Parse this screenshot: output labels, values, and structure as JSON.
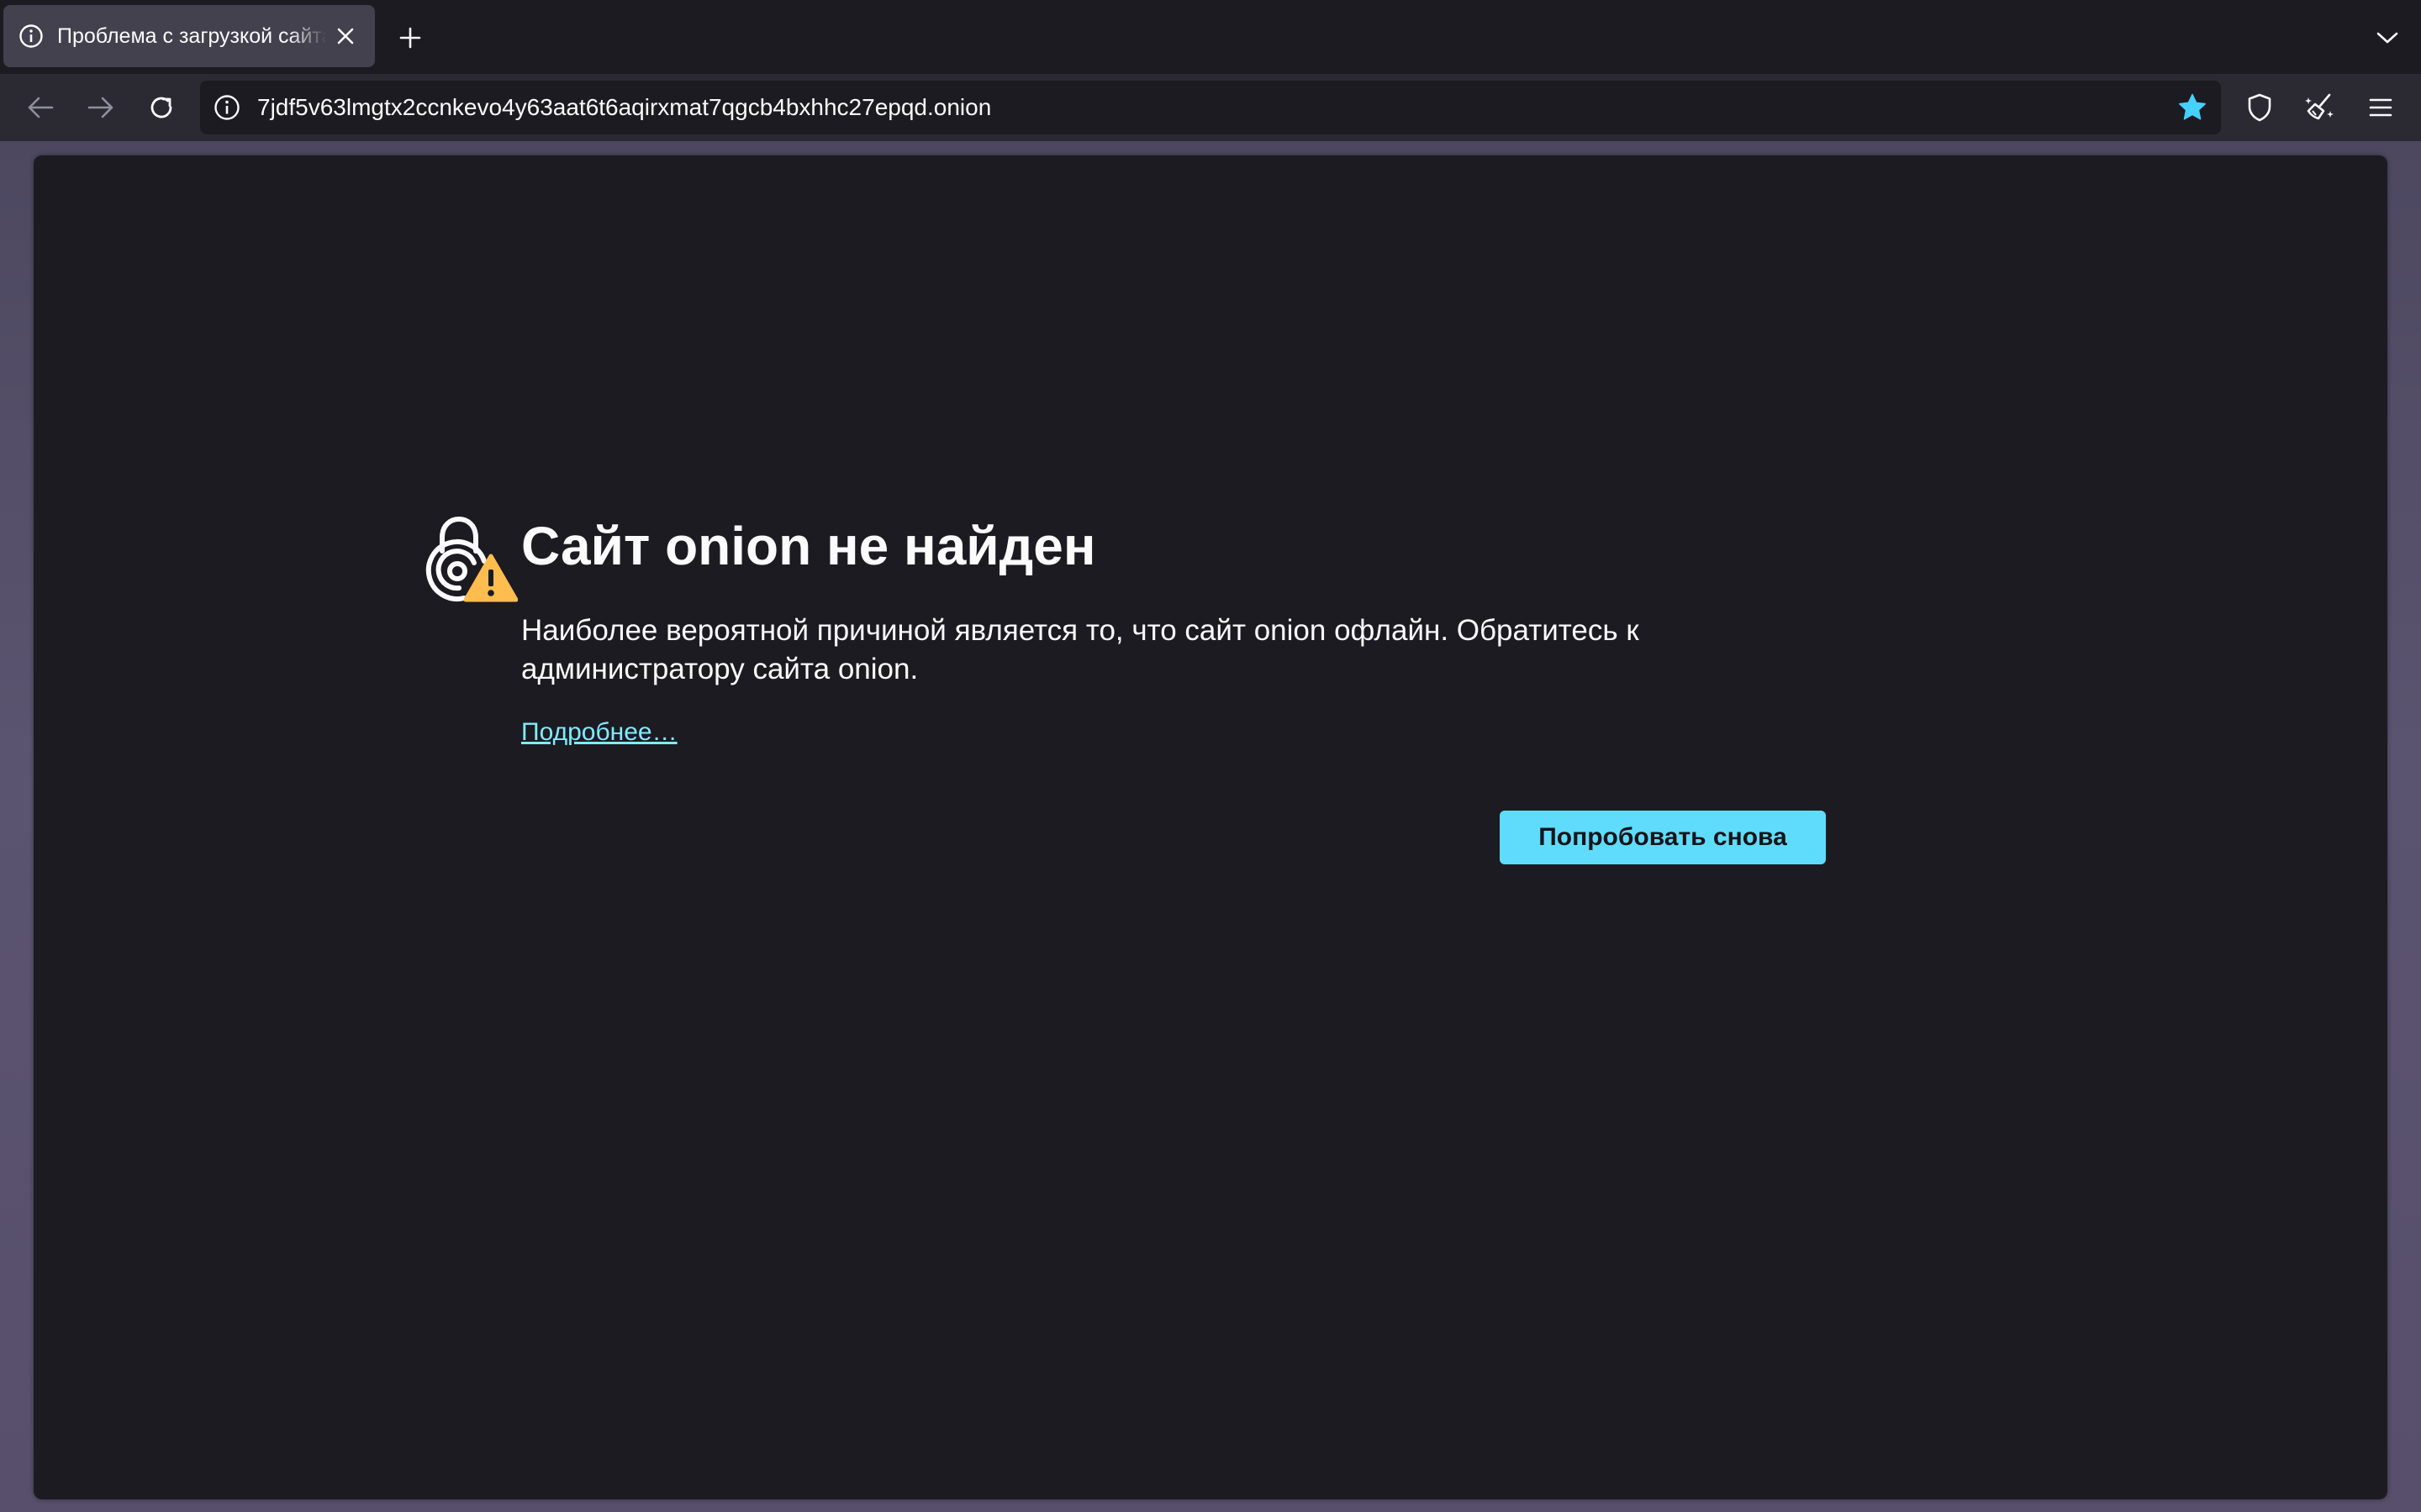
{
  "tab": {
    "title": "Проблема с загрузкой сайта Onion"
  },
  "urlbar": {
    "url": "7jdf5v63lmgtx2ccnkevo4y63aat6t6aqirxmat7qgcb4bxhhc27epqd.onion"
  },
  "icons": {
    "tab_info": "info-icon",
    "tab_close": "close-icon",
    "new_tab": "plus-icon",
    "tab_list": "chevron-down-icon",
    "back": "arrow-left-icon",
    "forward": "arrow-right-icon",
    "reload": "reload-icon",
    "site_info": "info-icon",
    "bookmark": "star-icon",
    "shield": "shield-icon",
    "new_identity": "broom-icon",
    "menu": "hamburger-icon",
    "error": "onion-lock-warning-icon"
  },
  "error_page": {
    "title": "Сайт onion не найден",
    "description": "Наиболее вероятной причиной является то, что сайт onion офлайн. Обратитесь к администратору сайта onion.",
    "learn_more": "Подробнее…",
    "retry_button": "Попробовать снова"
  },
  "colors": {
    "accent": "#80ebff",
    "bookmark_star": "#45d1fe",
    "warning": "#ffbd4f"
  }
}
